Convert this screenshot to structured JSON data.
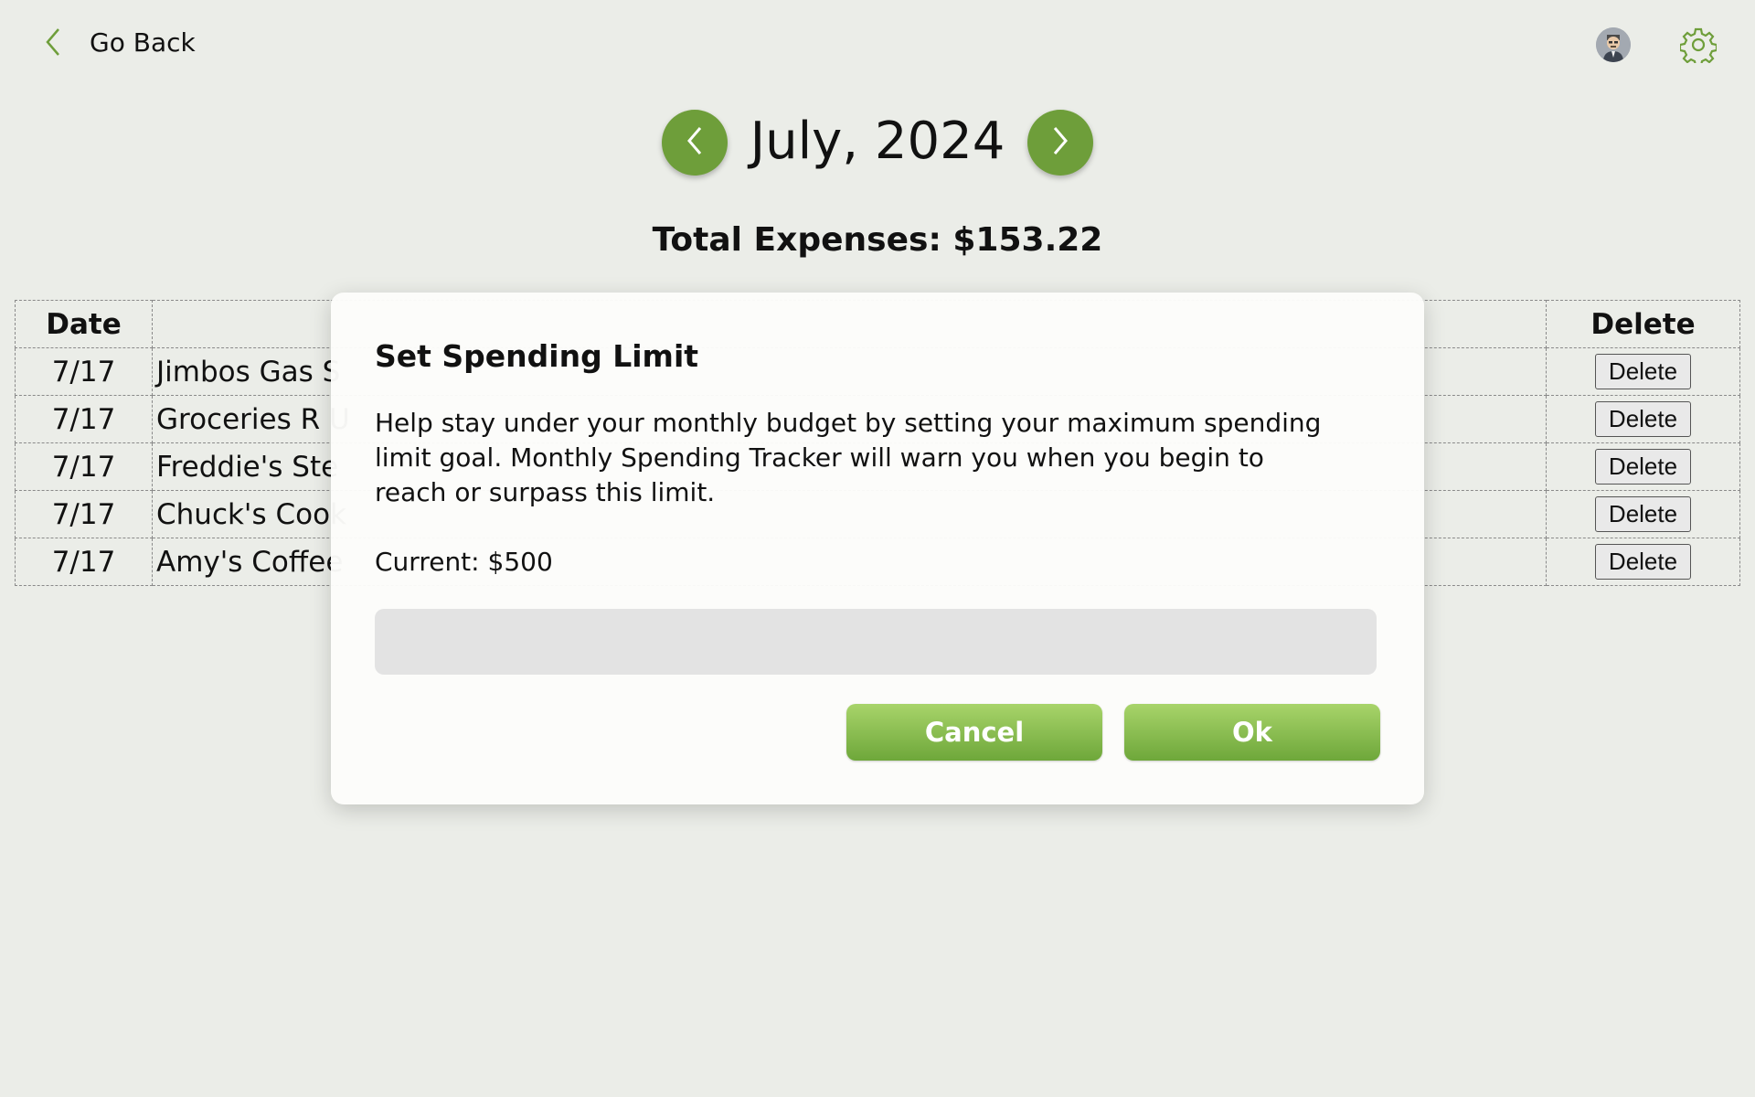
{
  "header": {
    "back_label": "Go Back",
    "avatar_icon": "user-avatar",
    "settings_icon": "gear-icon"
  },
  "month_nav": {
    "title": "July, 2024",
    "prev_icon": "chevron-left-icon",
    "next_icon": "chevron-right-icon"
  },
  "summary": {
    "total_label": "Total Expenses: $153.22"
  },
  "table": {
    "headers": {
      "date": "Date",
      "description": "",
      "delete": "Delete"
    },
    "rows": [
      {
        "date": "7/17",
        "description": "Jimbos Gas S",
        "delete_label": "Delete"
      },
      {
        "date": "7/17",
        "description": "Groceries R U",
        "delete_label": "Delete"
      },
      {
        "date": "7/17",
        "description": "Freddie's Ste",
        "delete_label": "Delete"
      },
      {
        "date": "7/17",
        "description": "Chuck's Cook",
        "delete_label": "Delete"
      },
      {
        "date": "7/17",
        "description": "Amy's Coffee",
        "delete_label": "Delete"
      }
    ]
  },
  "modal": {
    "title": "Set Spending Limit",
    "description": "Help stay under your monthly budget by setting your maximum spending limit goal. Monthly Spending Tracker will warn you when you begin to reach or surpass this limit.",
    "current": "Current: $500",
    "input_value": "",
    "input_placeholder": "",
    "cancel_label": "Cancel",
    "ok_label": "Ok"
  },
  "colors": {
    "background": "#ebede8",
    "accent": "#6e9e3a",
    "button_gradient_top": "#a8d46a",
    "button_gradient_bottom": "#6ea73a"
  }
}
